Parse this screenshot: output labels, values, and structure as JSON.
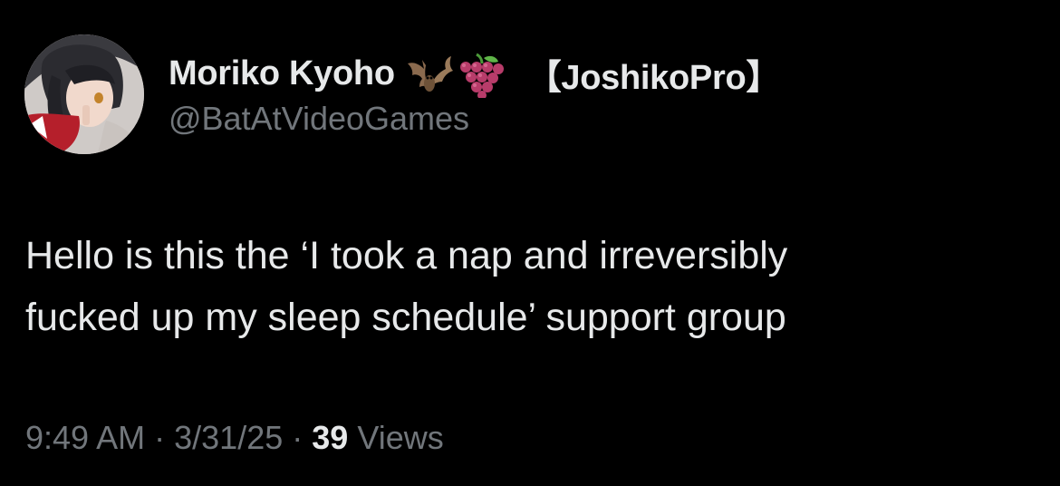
{
  "author": {
    "display_name": "Moriko Kyoho",
    "emoji": [
      "bat-emoji",
      "grapes-emoji"
    ],
    "tag": "【JoshikoPro】",
    "handle": "@BatAtVideoGames"
  },
  "tweet": {
    "text_lines": [
      "Hello is this the ‘I took a nap and irreversibly",
      "fucked up my sleep schedule’ support group"
    ]
  },
  "meta": {
    "time": "9:49 AM",
    "separator": "·",
    "date": "3/31/25",
    "views_count": "39",
    "views_label": "Views"
  },
  "colors": {
    "background": "#000000",
    "primary_text": "#e7e9ea",
    "secondary_text": "#71767b"
  }
}
